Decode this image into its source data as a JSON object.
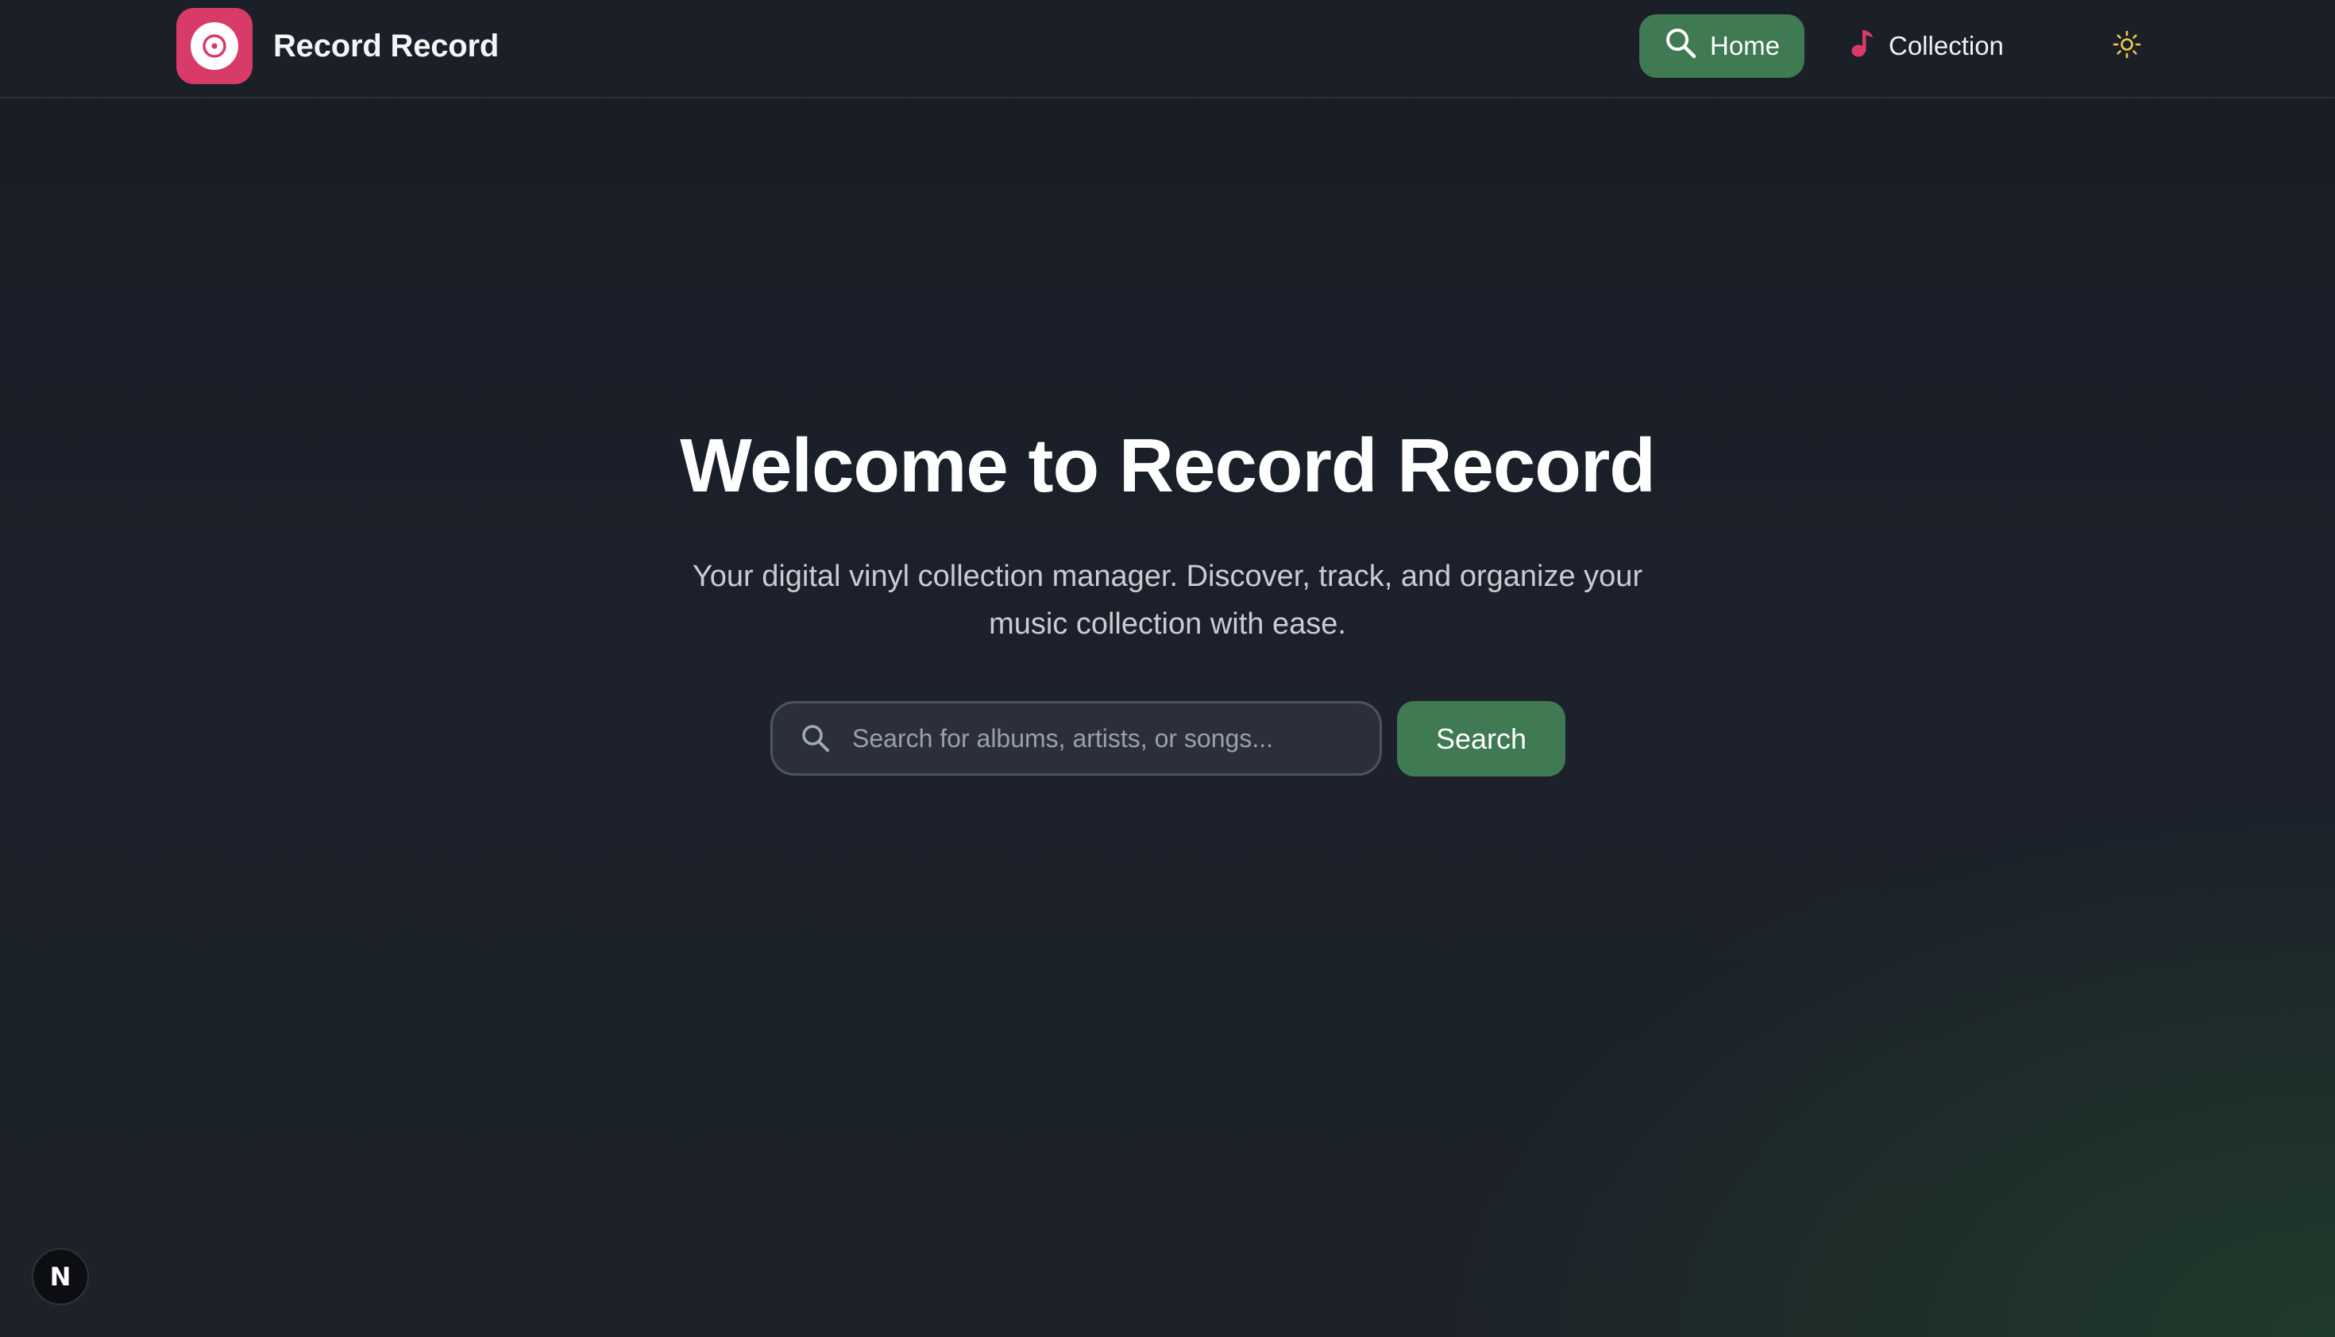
{
  "app": {
    "name": "Record Record"
  },
  "nav": {
    "items": [
      {
        "label": "Home",
        "icon": "search-icon",
        "active": true
      },
      {
        "label": "Collection",
        "icon": "music-note-icon",
        "active": false
      }
    ],
    "theme_toggle_icon": "sun-icon"
  },
  "hero": {
    "title": "Welcome to Record Record",
    "subtitle": "Your digital vinyl collection manager. Discover, track, and organize your music collection with ease."
  },
  "search": {
    "placeholder": "Search for albums, artists, or songs...",
    "value": "",
    "button_label": "Search"
  },
  "dev_badge": {
    "label": "N"
  },
  "colors": {
    "accent_green": "#3f7a53",
    "brand_pink": "#d93b68",
    "sun_yellow": "#f2c94c",
    "background": "#1b1f28"
  }
}
